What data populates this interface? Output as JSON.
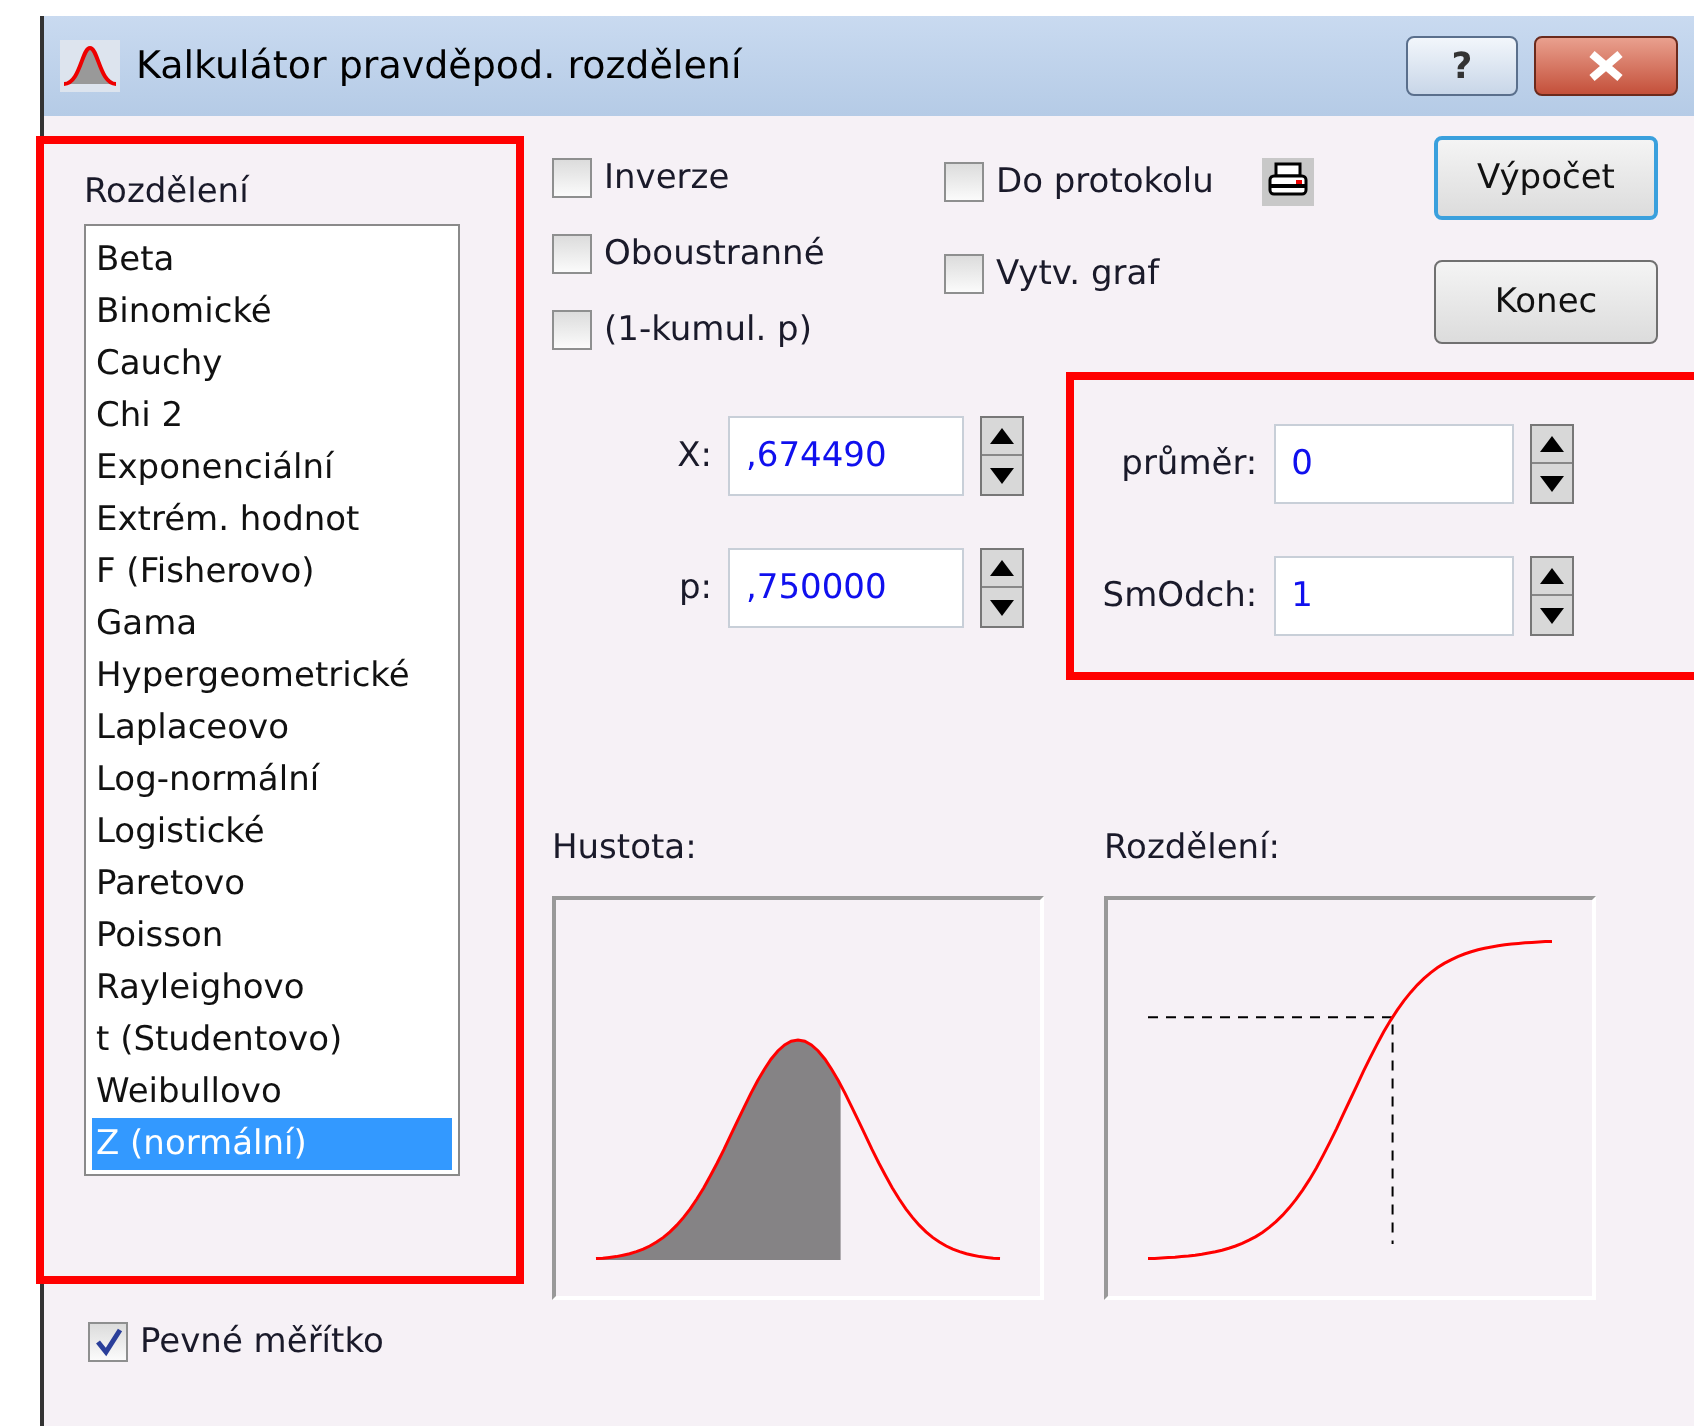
{
  "window": {
    "title": "Kalkulátor pravděpod. rozdělení",
    "help": "?"
  },
  "distribution_list": {
    "label": "Rozdělení",
    "items": [
      {
        "label": "Beta",
        "selected": false
      },
      {
        "label": "Binomické",
        "selected": false
      },
      {
        "label": "Cauchy",
        "selected": false
      },
      {
        "label": "Chi 2",
        "selected": false
      },
      {
        "label": "Exponenciální",
        "selected": false
      },
      {
        "label": "Extrém. hodnot",
        "selected": false
      },
      {
        "label": "F (Fisherovo)",
        "selected": false
      },
      {
        "label": "Gama",
        "selected": false
      },
      {
        "label": "Hypergeometrické",
        "selected": false
      },
      {
        "label": "Laplaceovo",
        "selected": false
      },
      {
        "label": "Log-normální",
        "selected": false
      },
      {
        "label": "Logistické",
        "selected": false
      },
      {
        "label": "Paretovo",
        "selected": false
      },
      {
        "label": "Poisson",
        "selected": false
      },
      {
        "label": "Rayleighovo",
        "selected": false
      },
      {
        "label": "t (Studentovo)",
        "selected": false
      },
      {
        "label": "Weibullovo",
        "selected": false
      },
      {
        "label": "Z (normální)",
        "selected": true
      }
    ]
  },
  "options_left": [
    {
      "label": "Inverze",
      "checked": false
    },
    {
      "label": "Oboustranné",
      "checked": false
    },
    {
      "label": "(1-kumul. p)",
      "checked": false
    }
  ],
  "options_right": [
    {
      "label": "Do protokolu",
      "checked": false
    },
    {
      "label": "Vytv. graf",
      "checked": false
    }
  ],
  "buttons": [
    {
      "label": "Výpočet",
      "focused": true
    },
    {
      "label": "Konec",
      "focused": false
    }
  ],
  "fields_left": [
    {
      "label": "X:",
      "value": ",674490"
    },
    {
      "label": "p:",
      "value": ",750000"
    }
  ],
  "fields_right": [
    {
      "label": "průměr:",
      "value": "0"
    },
    {
      "label": "SmOdch:",
      "value": "1"
    }
  ],
  "charts": [
    {
      "kind": "density",
      "title": "Hustota:"
    },
    {
      "kind": "cdf",
      "title": "Rozdělení:"
    }
  ],
  "fixed_scale": {
    "label": "Pevné měřítko",
    "checked": true
  }
}
